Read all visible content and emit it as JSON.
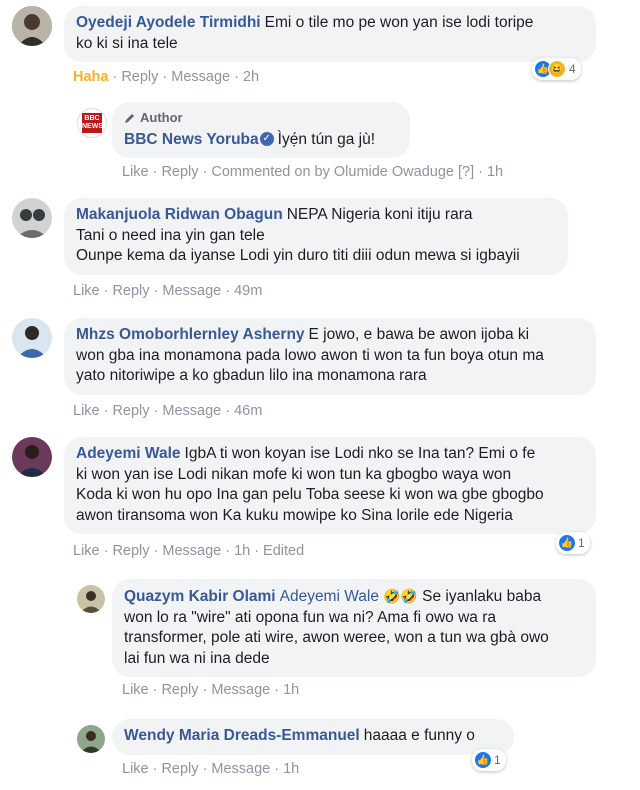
{
  "comments": [
    {
      "name": "Oyedeji Ayodele Tirmidhi",
      "lines": [
        "Emi o tile mo pe won yan ise lodi toripe",
        "ko ki si ina tele"
      ],
      "actions": [
        "Haha",
        "Reply",
        "Message",
        "2h"
      ],
      "reactions": {
        "count": "4",
        "types": [
          "like-icon",
          "haha-icon"
        ]
      }
    },
    {
      "author_tag": "Author",
      "name": "BBC News Yoruba",
      "lines": [
        "Ìyẹ́n tún ga jù!"
      ],
      "actions": [
        "Like",
        "Reply",
        "Commented on by Olumide Owaduge [?]",
        "1h"
      ],
      "avatar_text": "BBC NEWS"
    },
    {
      "name": "Makanjuola Ridwan Obagun",
      "lines": [
        "NEPA Nigeria koni itiju rara",
        "Tani o need ina yin gan tele",
        "Ounpe kema da iyanse Lodi yin duro titi diii odun mewa si igbayii"
      ],
      "actions": [
        "Like",
        "Reply",
        "Message",
        "49m"
      ]
    },
    {
      "name": "Mhzs Omoborhlernley Asherny",
      "lines": [
        "E jowo, e bawa be awon ijoba ki",
        "won gba ina monamona pada lowo awon ti won ta fun boya otun ma",
        "yato nitoriwipe a ko gbadun lilo ina monamona rara"
      ],
      "actions": [
        "Like",
        "Reply",
        "Message",
        "46m"
      ]
    },
    {
      "name": "Adeyemi Wale",
      "lines": [
        "IgbA ti won koyan ise Lodi nko se Ina tan? Emi o fe",
        "ki won yan ise Lodi nikan mofe ki won tun ka gbogbo waya won",
        "Koda ki won hu opo Ina gan pelu Toba seese ki won wa gbe gbogbo",
        "awon tiransoma won Ka kuku mowipe ko Sina lorile ede Nigeria"
      ],
      "actions": [
        "Like",
        "Reply",
        "Message",
        "1h",
        "Edited"
      ],
      "reactions": {
        "count": "1",
        "types": [
          "like-icon"
        ]
      }
    },
    {
      "name": "Quazym Kabir Olami",
      "mention": "Adeyemi Wale",
      "emojis": "🤣🤣",
      "lines": [
        "Se iyanlaku baba",
        "won lo ra \"wire\" ati opona fun wa ni? Ama fi owo wa ra",
        "transformer, pole ati wire, awon weree, won a tun wa gbà owo",
        "lai fun wa ni ina dede"
      ],
      "actions": [
        "Like",
        "Reply",
        "Message",
        "1h"
      ]
    },
    {
      "name": "Wendy Maria Dreads-Emmanuel",
      "lines": [
        "haaaa e funny o"
      ],
      "actions": [
        "Like",
        "Reply",
        "Message",
        "1h"
      ],
      "reactions": {
        "count": "1",
        "types": [
          "like-icon"
        ]
      }
    }
  ],
  "colors": {
    "name": "#385898",
    "bubble": "#f2f3f5",
    "meta": "#8d949e",
    "haha": "#f7b125",
    "like": "#1877f2",
    "bbc": "#bb1919"
  }
}
